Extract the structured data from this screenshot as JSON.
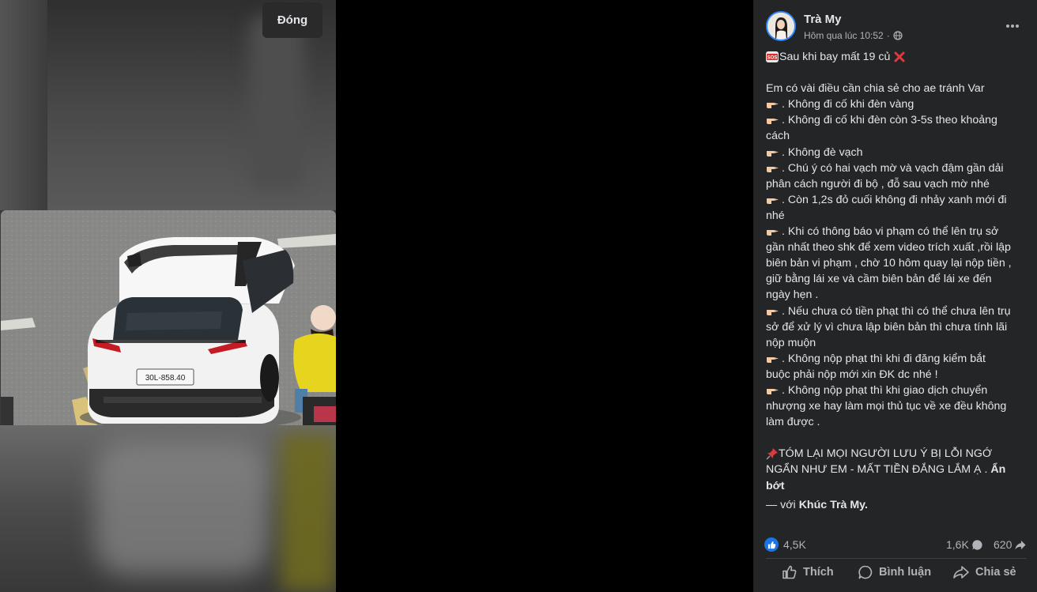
{
  "viewer": {
    "close_label": "Đóng"
  },
  "post": {
    "author": "Trà My",
    "time": "Hôm qua lúc 10:52",
    "privacy_separator": "·",
    "headline_text": "Sau khi bay mất 19 củ",
    "lines": [
      "Em có vài điều cần chia sẻ cho ae tránh Var",
      ". Không đi cố khi đèn vàng",
      ". Không đi cố khi đèn còn 3-5s theo khoảng",
      "cách",
      ". Không đè vạch",
      ". Chú ý có hai vạch mờ và vạch đậm gần dải",
      "phân cách người đi bộ , đỗ sau vạch mờ nhé",
      ". Còn 1,2s đỏ cuối không đi nhảy xanh mới đi",
      "nhé",
      ". Khi có thông báo vi phạm có thể lên trụ sở",
      "gần nhất theo shk để xem video trích xuất ,rồi lập",
      "biên bản vi phạm , chờ 10 hôm quay lại nộp tiền ,",
      "giữ bằng lái xe và cầm biên bản để lái xe đến",
      "ngày hẹn .",
      ". Nếu chưa có tiền phạt thì có thể chưa lên trụ",
      "sở để xử lý vì chưa lập biên bản thì chưa tính lãi",
      "nộp muộn",
      ". Không nộp phạt thì khi đi đăng kiểm bắt",
      "buộc phải nộp mới xin ĐK dc nhé !",
      ". Không nộp phạt thì khi giao dịch chuyển",
      "nhượng xe hay làm mọi thủ tục về xe đều không",
      "làm được ."
    ],
    "summary_line1": " TÓM LẠI MỌI NGƯỜI LƯU Ý BỊ LỖI NGỚ",
    "summary_line2": "NGẨN NHƯ EM - MẤT TIỀN ĐẮNG LẮM Ạ .",
    "see_less": "Ẩn",
    "see_less_2": "bớt",
    "with_prefix": "— với",
    "tagged": "Khúc Trà My.",
    "license_plate": "30L-858.40"
  },
  "stats": {
    "likes": "4,5K",
    "comments": "1,6K",
    "shares": "620"
  },
  "actions": {
    "like": "Thích",
    "comment": "Bình luận",
    "share": "Chia sẻ"
  },
  "colors": {
    "panel": "#242526",
    "text": "#e4e6eb",
    "muted": "#b0b3b8",
    "accent": "#1b74e4"
  }
}
